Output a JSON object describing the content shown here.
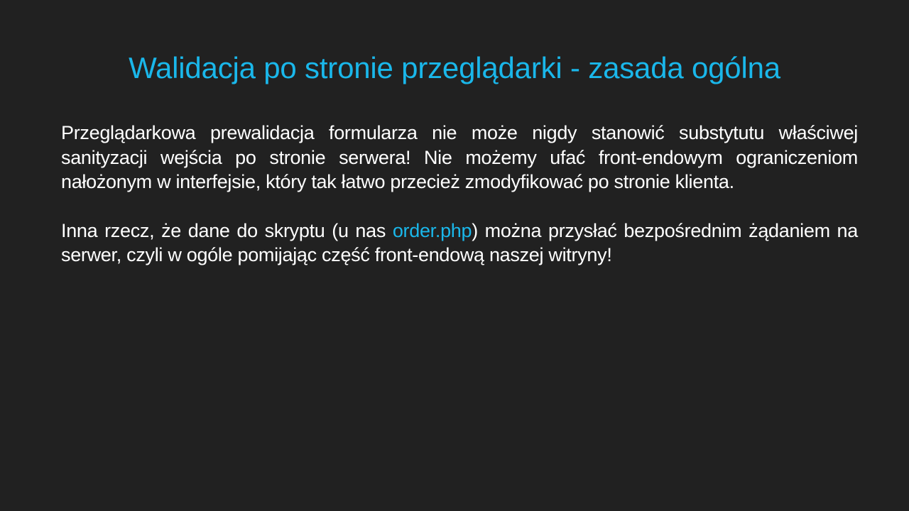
{
  "slide": {
    "title": "Walidacja po stronie przeglądarki - zasada ogólna",
    "paragraph1": "Przeglądarkowa prewalidacja formularza nie może nigdy stanowić substytutu właściwej sanityzacji wejścia po stronie serwera! Nie możemy ufać front-endowym ograniczeniom nałożonym w interfejsie, który tak łatwo przecież zmodyfikować po stronie klienta.",
    "paragraph2_before": "Inna rzecz, że dane do skryptu (u nas ",
    "paragraph2_highlight": "order.php",
    "paragraph2_after": ") można przysłać bezpośrednim żądaniem na serwer, czyli w ogóle pomijając część front-endową naszej witryny!"
  },
  "colors": {
    "background": "#212121",
    "accent": "#1ab7ea",
    "text": "#ffffff"
  }
}
